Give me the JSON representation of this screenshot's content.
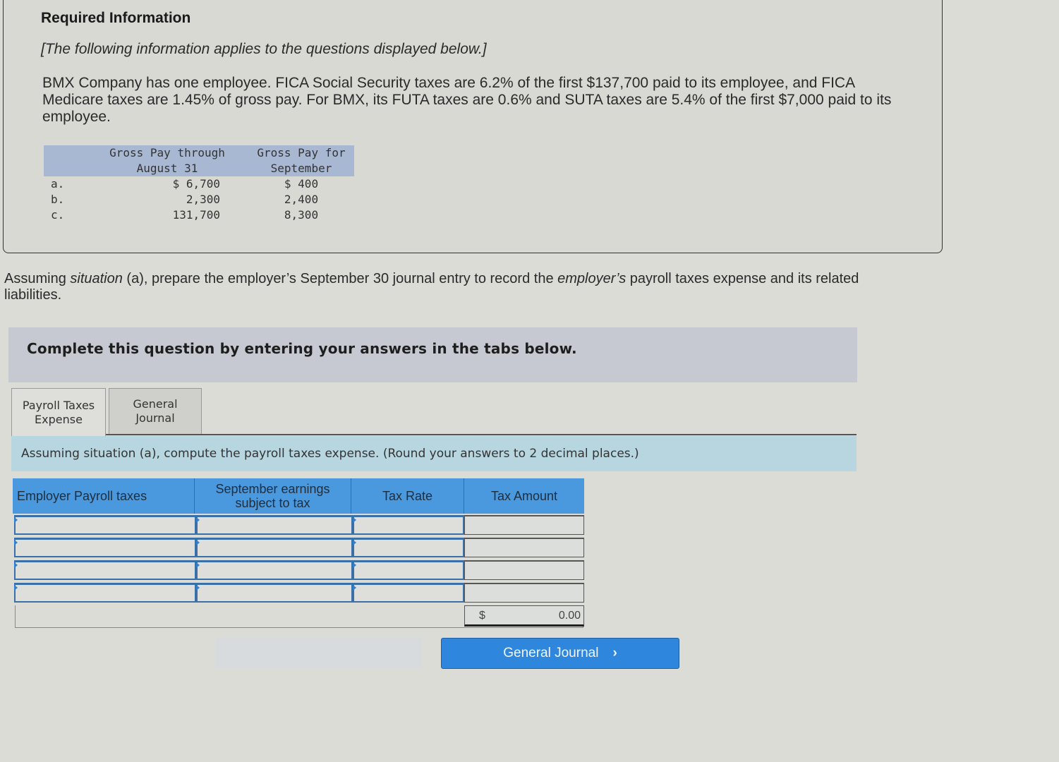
{
  "info": {
    "title": "Required Information",
    "subtitle": "[The following information applies to the questions displayed below.]",
    "body": "BMX Company has one employee. FICA Social Security taxes are 6.2% of the first $137,700 paid to its employee, and FICA Medicare taxes are 1.45% of gross pay. For BMX, its FUTA taxes are 0.6% and SUTA taxes are 5.4% of the first $7,000 paid to its employee.",
    "table": {
      "headers": [
        "",
        "Gross Pay through August 31",
        "Gross Pay for September"
      ],
      "rows": [
        {
          "label": "a.",
          "through_aug": "$ 6,700",
          "september": "$ 400"
        },
        {
          "label": "b.",
          "through_aug": "2,300",
          "september": "2,400"
        },
        {
          "label": "c.",
          "through_aug": "131,700",
          "september": "8,300"
        }
      ]
    }
  },
  "question": {
    "part1": "Assuming ",
    "situation_italic": "situation",
    "part2": " (a), prepare the employer’s September 30 journal entry to record the ",
    "employer_italic": "employer’s",
    "part3": " payroll taxes expense and its related liabilities."
  },
  "instructions": "Complete this question by entering your answers in the tabs below.",
  "tabs": [
    {
      "label_line1": "Payroll Taxes",
      "label_line2": "Expense",
      "active": true
    },
    {
      "label_line1": "General",
      "label_line2": "Journal",
      "active": false
    }
  ],
  "prompt": "Assuming situation (a), compute the payroll taxes expense. (Round your answers to 2 decimal places.)",
  "grid": {
    "headers": [
      "Employer Payroll taxes",
      "September earnings subject to tax",
      "Tax Rate",
      "Tax Amount"
    ],
    "rows": [
      {
        "tax": "",
        "earnings": "",
        "rate": "",
        "amount": ""
      },
      {
        "tax": "",
        "earnings": "",
        "rate": "",
        "amount": ""
      },
      {
        "tax": "",
        "earnings": "",
        "rate": "",
        "amount": ""
      },
      {
        "tax": "",
        "earnings": "",
        "rate": "",
        "amount": ""
      }
    ],
    "total_currency": "$",
    "total_value": "0.00"
  },
  "nav": {
    "prev_label": "",
    "next_label": "General Journal",
    "next_icon": "chevron-right-icon"
  }
}
